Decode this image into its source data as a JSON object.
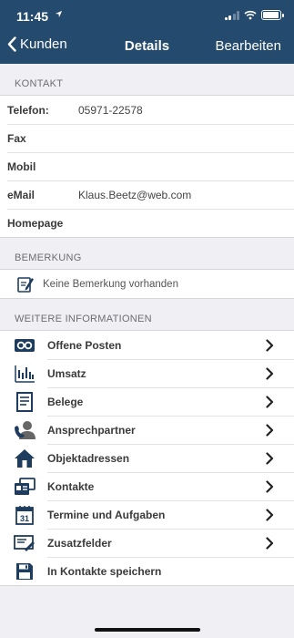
{
  "status_bar": {
    "time": "11:45",
    "location_icon": "location-arrow-icon",
    "signal_icon": "cellular-signal-icon",
    "wifi_icon": "wifi-icon",
    "battery_level": 0.95
  },
  "nav": {
    "back_label": "Kunden",
    "title": "Details",
    "edit_label": "Bearbeiten"
  },
  "contact": {
    "header": "KONTAKT",
    "rows": [
      {
        "label": "Telefon:",
        "value": "05971-22578"
      },
      {
        "label": "Fax",
        "value": ""
      },
      {
        "label": "Mobil",
        "value": ""
      },
      {
        "label": "eMail",
        "value": "Klaus.Beetz@web.com"
      },
      {
        "label": "Homepage",
        "value": ""
      }
    ]
  },
  "remark": {
    "header": "BEMERKUNG",
    "text": "Keine Bemerkung vorhanden",
    "icon": "note-edit-icon"
  },
  "more": {
    "header": "WEITERE INFORMATIONEN",
    "items": [
      {
        "label": "Offene Posten",
        "icon": "open-items-icon",
        "chevron": true
      },
      {
        "label": "Umsatz",
        "icon": "revenue-chart-icon",
        "chevron": true
      },
      {
        "label": "Belege",
        "icon": "documents-icon",
        "chevron": true
      },
      {
        "label": "Ansprechpartner",
        "icon": "contact-person-icon",
        "chevron": true
      },
      {
        "label": "Objektadressen",
        "icon": "house-icon",
        "chevron": true
      },
      {
        "label": "Kontakte",
        "icon": "contacts-icon",
        "chevron": true
      },
      {
        "label": "Termine und Aufgaben",
        "icon": "calendar-icon",
        "chevron": true
      },
      {
        "label": "Zusatzfelder",
        "icon": "additional-fields-icon",
        "chevron": true
      },
      {
        "label": "In Kontakte speichern",
        "icon": "save-disk-icon",
        "chevron": false
      }
    ]
  },
  "colors": {
    "nav_bg": "#244a6e",
    "icon": "#1e3d5e",
    "background": "#efeff4"
  }
}
